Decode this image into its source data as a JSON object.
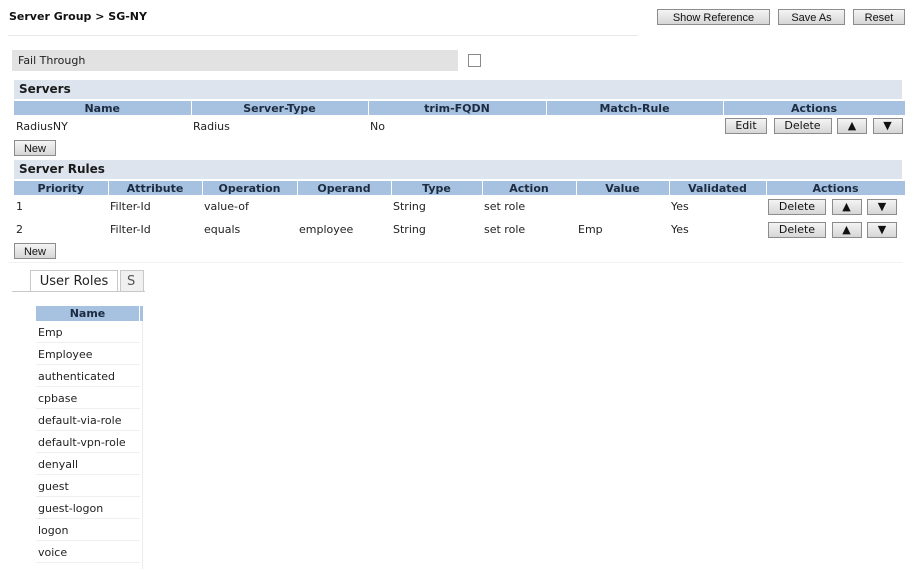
{
  "header": {
    "title": "Server Group > SG-NY",
    "show_reference": "Show Reference",
    "save_as": "Save As",
    "reset": "Reset"
  },
  "fail_through": {
    "label": "Fail Through",
    "checked": false
  },
  "servers": {
    "section_title": "Servers",
    "columns": [
      "Name",
      "Server-Type",
      "trim-FQDN",
      "Match-Rule",
      "Actions"
    ],
    "rows": [
      {
        "name": "RadiusNY",
        "server_type": "Radius",
        "trim_fqdn": "No",
        "match_rule": "",
        "edit": "Edit",
        "delete": "Delete",
        "up": "▲",
        "down": "▼"
      }
    ],
    "new_label": "New"
  },
  "server_rules": {
    "section_title": "Server Rules",
    "columns": [
      "Priority",
      "Attribute",
      "Operation",
      "Operand",
      "Type",
      "Action",
      "Value",
      "Validated",
      "Actions"
    ],
    "rows": [
      {
        "priority": "1",
        "attribute": "Filter-Id",
        "operation": "value-of",
        "operand": "",
        "type": "String",
        "action": "set role",
        "value": "",
        "validated": "Yes",
        "delete": "Delete",
        "up": "▲",
        "down": "▼"
      },
      {
        "priority": "2",
        "attribute": "Filter-Id",
        "operation": "equals",
        "operand": "employee",
        "type": "String",
        "action": "set role",
        "value": "Emp",
        "validated": "Yes",
        "delete": "Delete",
        "up": "▲",
        "down": "▼"
      }
    ],
    "new_label": "New"
  },
  "tabs": {
    "active": "User Roles",
    "second_partial": "S"
  },
  "user_roles": {
    "header": "Name",
    "items": [
      "Emp",
      "Employee",
      "authenticated",
      "cpbase",
      "default-via-role",
      "default-vpn-role",
      "denyall",
      "guest",
      "guest-logon",
      "logon",
      "voice"
    ]
  },
  "colors": {
    "table_header": "#a6c2e0",
    "section_bar": "#dde4ee",
    "fail_bar": "#e2e2e2"
  }
}
